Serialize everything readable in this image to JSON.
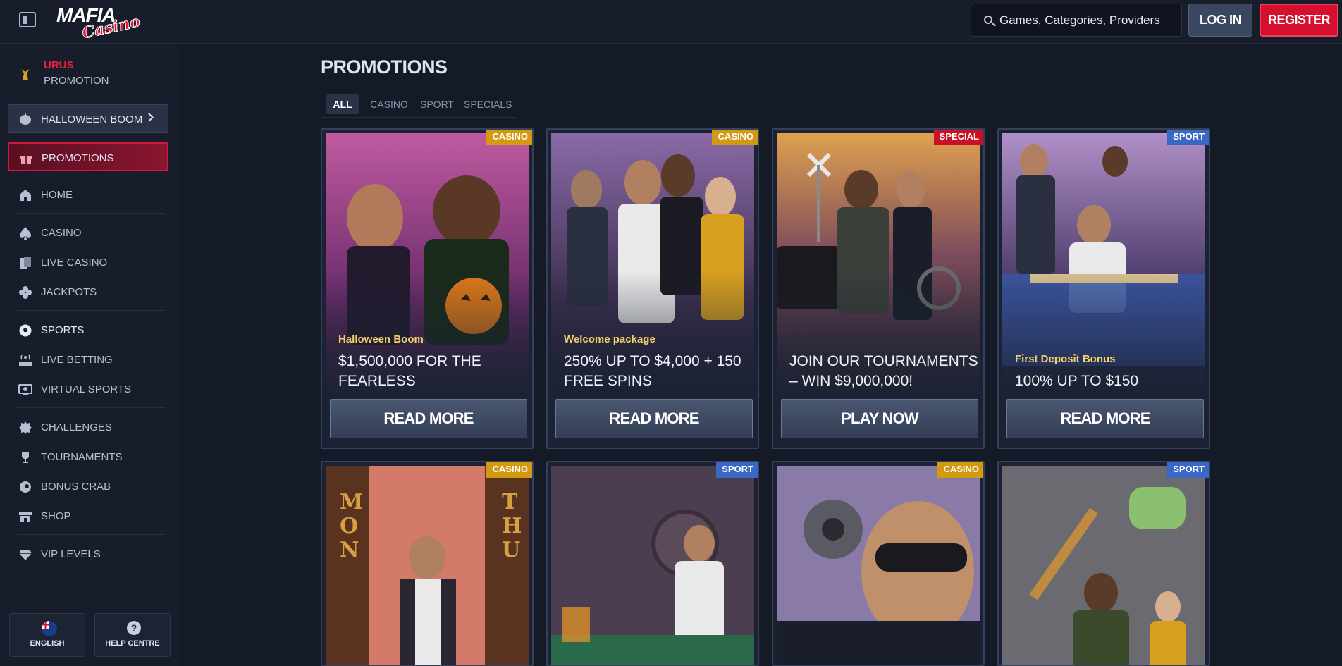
{
  "header": {
    "logo_primary": "MAFIA",
    "logo_secondary": "Casino",
    "search_placeholder": "Games, Categories, Providers",
    "login_label": "LOG IN",
    "register_label": "REGISTER"
  },
  "sidebar": {
    "urus_title": "URUS",
    "urus_subtitle": "PROMOTION",
    "halloween_label": "HALLOWEEN BOOM",
    "promotions_label": "PROMOTIONS",
    "items": [
      {
        "label": "HOME",
        "icon": "home-icon"
      },
      {
        "label": "CASINO",
        "icon": "spade-icon"
      },
      {
        "label": "LIVE CASINO",
        "icon": "cards-icon"
      },
      {
        "label": "JACKPOTS",
        "icon": "clover-icon"
      },
      {
        "label": "SPORTS",
        "icon": "soccer-ball-icon"
      },
      {
        "label": "LIVE BETTING",
        "icon": "live-icon"
      },
      {
        "label": "VIRTUAL SPORTS",
        "icon": "virtual-icon"
      },
      {
        "label": "CHALLENGES",
        "icon": "badge-icon"
      },
      {
        "label": "TOURNAMENTS",
        "icon": "trophy-icon"
      },
      {
        "label": "BONUS CRAB",
        "icon": "crab-icon"
      },
      {
        "label": "SHOP",
        "icon": "shop-icon"
      },
      {
        "label": "VIP LEVELS",
        "icon": "diamond-icon"
      }
    ],
    "language_label": "ENGLISH",
    "help_label": "HELP CENTRE"
  },
  "main": {
    "page_title": "PROMOTIONS",
    "tabs": [
      "ALL",
      "CASINO",
      "SPORT",
      "SPECIALS"
    ],
    "cards": [
      {
        "badge": "CASINO",
        "subtitle": "Halloween Boom",
        "title": "$1,500,000 FOR THE FEARLESS",
        "cta": "READ MORE"
      },
      {
        "badge": "CASINO",
        "subtitle": "Welcome package",
        "title": "250% UP TO $4,000 + 150 FREE SPINS",
        "cta": "READ MORE"
      },
      {
        "badge": "SPECIAL",
        "subtitle": "",
        "title": "JOIN OUR TOURNAMENTS – WIN $9,000,000!",
        "cta": "PLAY NOW"
      },
      {
        "badge": "SPORT",
        "subtitle": "First Deposit Bonus",
        "title": "100% UP TO $150",
        "cta": "READ MORE"
      },
      {
        "badge": "CASINO",
        "art_text_left": "MON",
        "art_text_right": "THU"
      },
      {
        "badge": "SPORT"
      },
      {
        "badge": "CASINO"
      },
      {
        "badge": "SPORT"
      }
    ]
  },
  "colors": {
    "background": "#141a26",
    "sidebar": "#171d2a",
    "accent_red": "#d4102e",
    "badge_casino": "#d19a12",
    "badge_sport": "#3a68c4",
    "badge_special": "#c81028",
    "subtitle_gold": "#f6d06a"
  }
}
